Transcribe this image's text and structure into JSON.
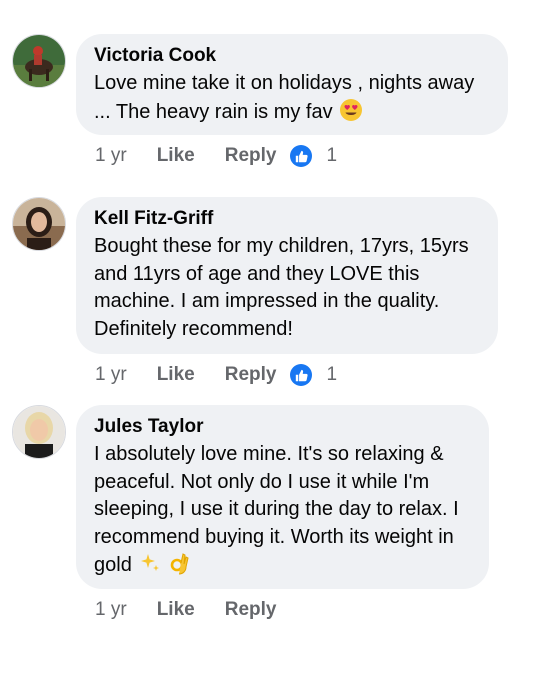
{
  "comments": [
    {
      "author": "Victoria Cook",
      "text": "Love mine take it on holidays , nights away\n... The heavy rain is my fav",
      "emoji": "heart-eyes-emoji",
      "time": "1 yr",
      "like_label": "Like",
      "reply_label": "Reply",
      "reaction_icon": "like-icon",
      "reaction_count": "1"
    },
    {
      "author": "Kell Fitz-Griff",
      "text": "Bought these for my children, 17yrs, 15yrs\nand 11yrs of age and they LOVE this\nmachine. I am impressed in the quality.\nDefinitely recommend!",
      "time": "1 yr",
      "like_label": "Like",
      "reply_label": "Reply",
      "reaction_icon": "like-icon",
      "reaction_count": "1"
    },
    {
      "author": "Jules Taylor",
      "text": "I absolutely love mine. It's so relaxing &\npeaceful. Not only do I use it while I'm\nsleeping, I use it during the day to relax. I\nrecommend buying it. Worth its weight in\ngold",
      "emoji": "sparkles-ok-hand-emoji",
      "time": "1 yr",
      "like_label": "Like",
      "reply_label": "Reply"
    }
  ],
  "colors": {
    "bubble": "#eff1f4",
    "secondary_text": "#65676b",
    "like_blue": "#1877f2"
  }
}
